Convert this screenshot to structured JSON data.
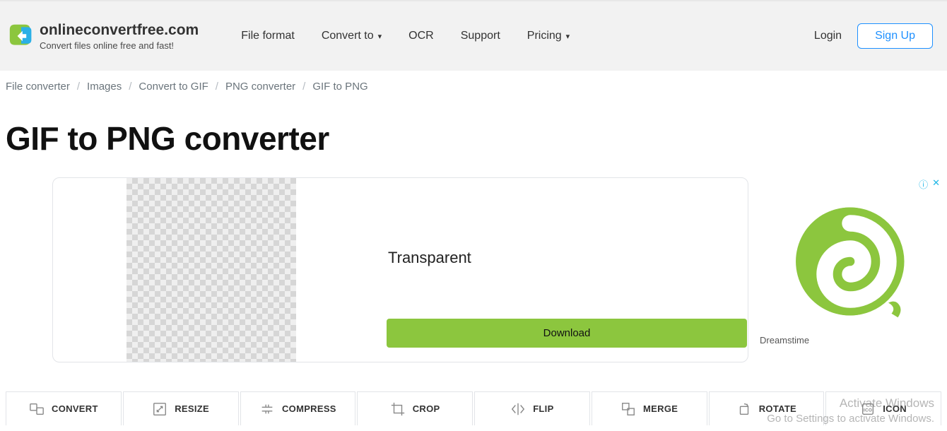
{
  "header": {
    "site_name": "onlineconvertfree.com",
    "tagline": "Convert files online free and fast!",
    "nav": {
      "file_format": "File format",
      "convert_to": "Convert to",
      "ocr": "OCR",
      "support": "Support",
      "pricing": "Pricing"
    },
    "auth": {
      "login": "Login",
      "signup": "Sign Up"
    }
  },
  "breadcrumbs": {
    "items": [
      "File converter",
      "Images",
      "Convert to GIF",
      "PNG converter",
      "GIF to PNG"
    ]
  },
  "page_title": "GIF to PNG converter",
  "ad_card": {
    "label": "Transparent",
    "download": "Download"
  },
  "side_ad": {
    "brand": "Dreamstime"
  },
  "tool_tabs": [
    "CONVERT",
    "RESIZE",
    "COMPRESS",
    "CROP",
    "FLIP",
    "MERGE",
    "ROTATE",
    "ICON"
  ],
  "watermark": {
    "line1": "Activate Windows",
    "line2": "Go to Settings to activate Windows."
  }
}
